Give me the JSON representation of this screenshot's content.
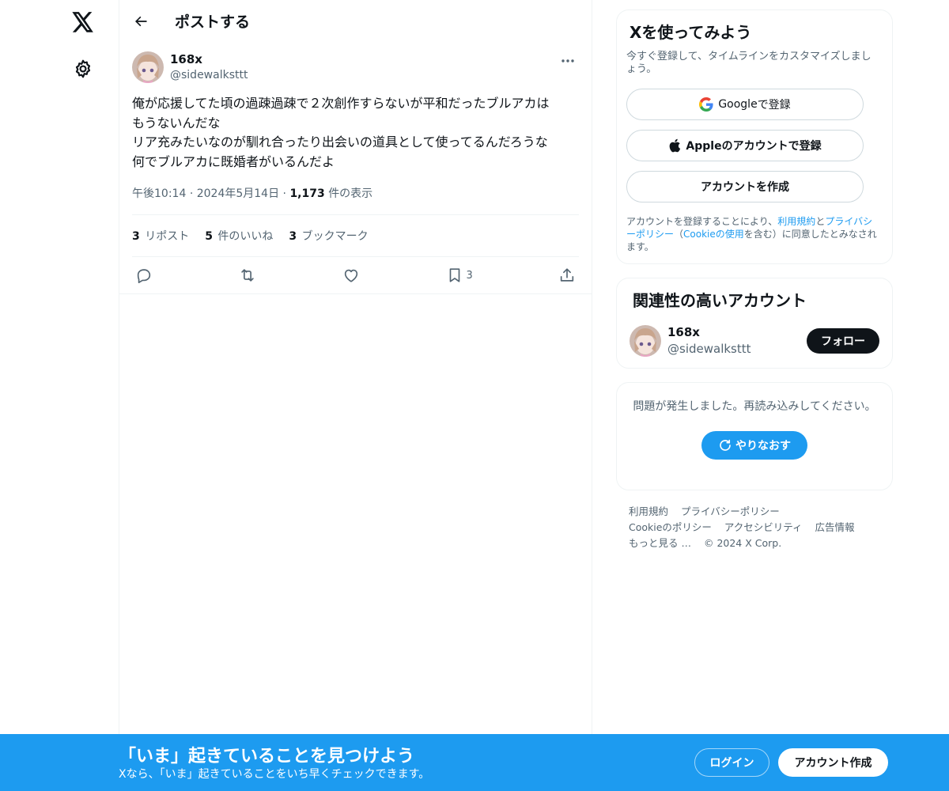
{
  "nav": {
    "logo_icon": "x-logo-icon",
    "settings_icon": "gear-icon"
  },
  "header": {
    "title": "ポストする",
    "back_icon": "arrow-left-icon"
  },
  "post": {
    "display_name": "168x",
    "handle": "@sidewalksttt",
    "text": "俺が応援してた頃の過疎過疎で２次創作すらないが平和だったブルアカは\nもうないんだな\nリア充みたいなのが馴れ合ったり出会いの道具として使ってるんだろうな\n何でブルアカに既婚者がいるんだよ",
    "time": "午後10:14",
    "date": "2024年5月14日",
    "views_count": "1,173",
    "views_label": "件の表示",
    "stats": {
      "reposts_count": "3",
      "reposts_label": "リポスト",
      "likes_count": "5",
      "likes_label": "件のいいね",
      "bookmarks_count": "3",
      "bookmarks_label": "ブックマーク"
    },
    "bookmark_action_count": "3"
  },
  "signup": {
    "title": "Xを使ってみよう",
    "subtitle": "今すぐ登録して、タイムラインをカスタマイズしましょう。",
    "google_brand": "Google",
    "google_suffix": " で登録",
    "apple_label": "Appleのアカウントで登録",
    "create_label": "アカウントを作成",
    "legal_prefix": "アカウントを登録することにより、",
    "terms_link": "利用規約",
    "legal_and": "と",
    "privacy_link": "プライバシーポリシー",
    "legal_paren_open": "（",
    "cookie_link": "Cookieの使用",
    "legal_suffix": "を含む）に同意したとみなされます。"
  },
  "related": {
    "title": "関連性の高いアカウント",
    "display_name": "168x",
    "handle": "@sidewalksttt",
    "follow_label": "フォロー"
  },
  "error": {
    "message": "問題が発生しました。再読み込みしてください。",
    "retry_label": "やりなおす"
  },
  "footer": {
    "terms": "利用規約",
    "privacy": "プライバシーポリシー",
    "cookie": "Cookieのポリシー",
    "accessibility": "アクセシビリティ",
    "ads": "広告情報",
    "more": "もっと見る …",
    "copyright": "© 2024 X Corp."
  },
  "banner": {
    "title": "「いま」起きていることを見つけよう",
    "subtitle": "Xなら、「いま」起きていることをいち早くチェックできます。",
    "login_label": "ログイン",
    "create_label": "アカウント作成"
  },
  "colors": {
    "accent": "#1d9bf0",
    "text": "#0f1419",
    "muted": "#536471",
    "border": "#eff3f4"
  }
}
